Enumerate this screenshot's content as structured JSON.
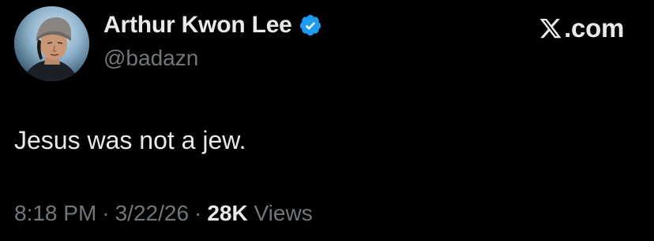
{
  "author": {
    "display_name": "Arthur Kwon Lee",
    "handle": "@badazn",
    "verified_icon": "verified-badge-icon",
    "verified_color": "#1d9bf0"
  },
  "brand": {
    "logo_icon": "x-logo-icon",
    "text": ".com"
  },
  "tweet": {
    "text": "Jesus was not a jew."
  },
  "meta": {
    "time": "8:18 PM",
    "separator": "·",
    "date": "3/22/26",
    "views_count": "28K",
    "views_label": "Views"
  },
  "colors": {
    "background": "#000000",
    "primary_text": "#e7e9ea",
    "secondary_text": "#71767b"
  }
}
